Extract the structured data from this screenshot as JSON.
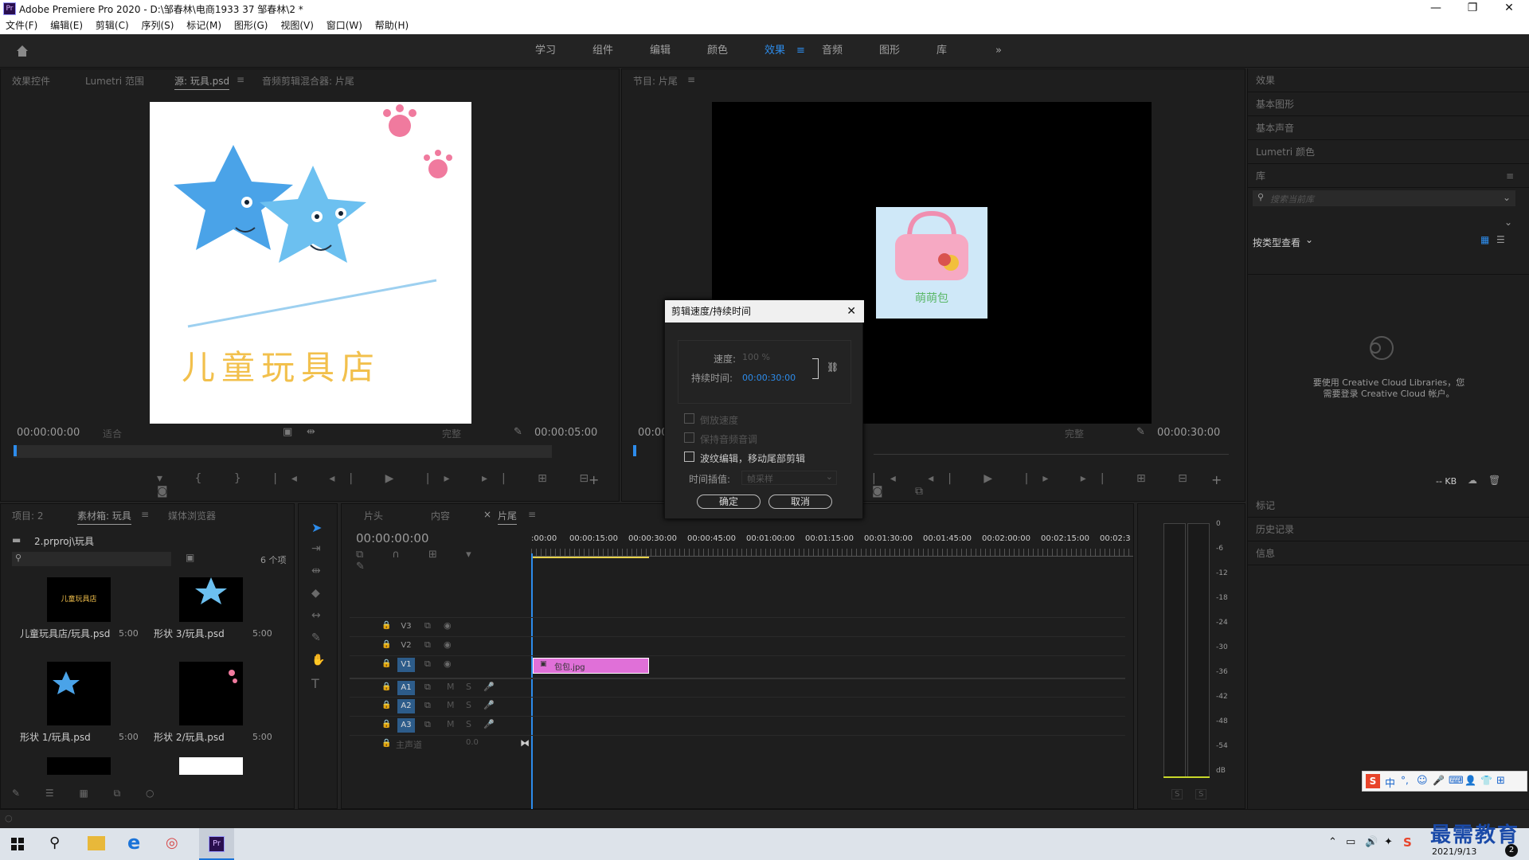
{
  "app": {
    "title": "Adobe Premiere Pro 2020 - D:\\邹春林\\电商1933 37 邹春林\\2 *",
    "badge": "Pr"
  },
  "window_controls": [
    "—",
    "❐",
    "✕"
  ],
  "menu": [
    "文件(F)",
    "编辑(E)",
    "剪辑(C)",
    "序列(S)",
    "标记(M)",
    "图形(G)",
    "视图(V)",
    "窗口(W)",
    "帮助(H)"
  ],
  "workspaces": {
    "items": [
      "学习",
      "组件",
      "编辑",
      "颜色",
      "效果",
      "音频",
      "图形",
      "库"
    ],
    "active": "效果",
    "more": "»"
  },
  "source": {
    "tabs": [
      "效果控件",
      "Lumetri 范围",
      "源: 玩具.psd",
      "音频剪辑混合器: 片尾"
    ],
    "timecode_in": "00:00:00:00",
    "fit": "适合",
    "quality": "完整",
    "timecode_out": "00:00:05:00",
    "image_text": "儿童玩具店"
  },
  "program": {
    "tab": "节目: 片尾",
    "timecode_in": "00:00",
    "quality": "完整",
    "timecode_out": "00:00:30:00",
    "thumb_text": "萌萌包"
  },
  "dialog": {
    "title": "剪辑速度/持续时间",
    "speed_label": "速度:",
    "speed_value": "100 %",
    "duration_label": "持续时间:",
    "duration_value": "00:00:30:00",
    "reverse": "倒放速度",
    "keep_pitch": "保持音频音调",
    "ripple": "波纹编辑，移动尾部剪辑",
    "interp_label": "时间插值:",
    "interp_value": "帧采样",
    "ok": "确定",
    "cancel": "取消"
  },
  "project": {
    "tabs": [
      "项目: 2",
      "素材箱: 玩具",
      "媒体浏览器"
    ],
    "path": "2.prproj\\玩具",
    "count": "6 个项",
    "items": [
      {
        "name": "儿童玩具店/玩具.psd",
        "dur": "5:00",
        "thumb": "儿童玩具店"
      },
      {
        "name": "形状 3/玩具.psd",
        "dur": "5:00"
      },
      {
        "name": "形状 1/玩具.psd",
        "dur": "5:00"
      },
      {
        "name": "形状 2/玩具.psd",
        "dur": "5:00"
      }
    ]
  },
  "timeline": {
    "tabs": [
      "片头",
      "内容",
      "片尾"
    ],
    "timecode": "00:00:00:00",
    "ruler": [
      ":00:00",
      "00:00:15:00",
      "00:00:30:00",
      "00:00:45:00",
      "00:01:00:00",
      "00:01:15:00",
      "00:01:30:00",
      "00:01:45:00",
      "00:02:00:00",
      "00:02:15:00",
      "00:02:3"
    ],
    "video_tracks": [
      "V3",
      "V2",
      "V1"
    ],
    "audio_tracks": [
      "A1",
      "A2",
      "A3"
    ],
    "master": "主声道",
    "master_value": "0.0",
    "clip_name": "包包.jpg",
    "mute_label": "M",
    "solo_label": "S"
  },
  "meter": {
    "scale": [
      "0",
      "-6",
      "-12",
      "-18",
      "-24",
      "-30",
      "-36",
      "-42",
      "-48",
      "-54",
      "dB"
    ],
    "solo": [
      "S",
      "S"
    ]
  },
  "right": {
    "tabs_top": [
      "效果",
      "基本图形",
      "基本声音",
      "Lumetri 颜色",
      "库"
    ],
    "search_placeholder": "搜索当前库",
    "view_label": "按类型查看",
    "cc_message_1": "要使用 Creative Cloud Libraries，您",
    "cc_message_2": "需要登录 Creative Cloud 帐户。",
    "kb": "-- KB",
    "tabs_bottom": [
      "标记",
      "历史记录",
      "信息"
    ]
  },
  "ime": {
    "items": [
      "中",
      "°,",
      "☺",
      "🎤",
      "⌨",
      "👤",
      "👕",
      "⊞"
    ]
  },
  "watermark": "最需教育",
  "clock": {
    "date": "2021/9/13",
    "badge": "2"
  }
}
